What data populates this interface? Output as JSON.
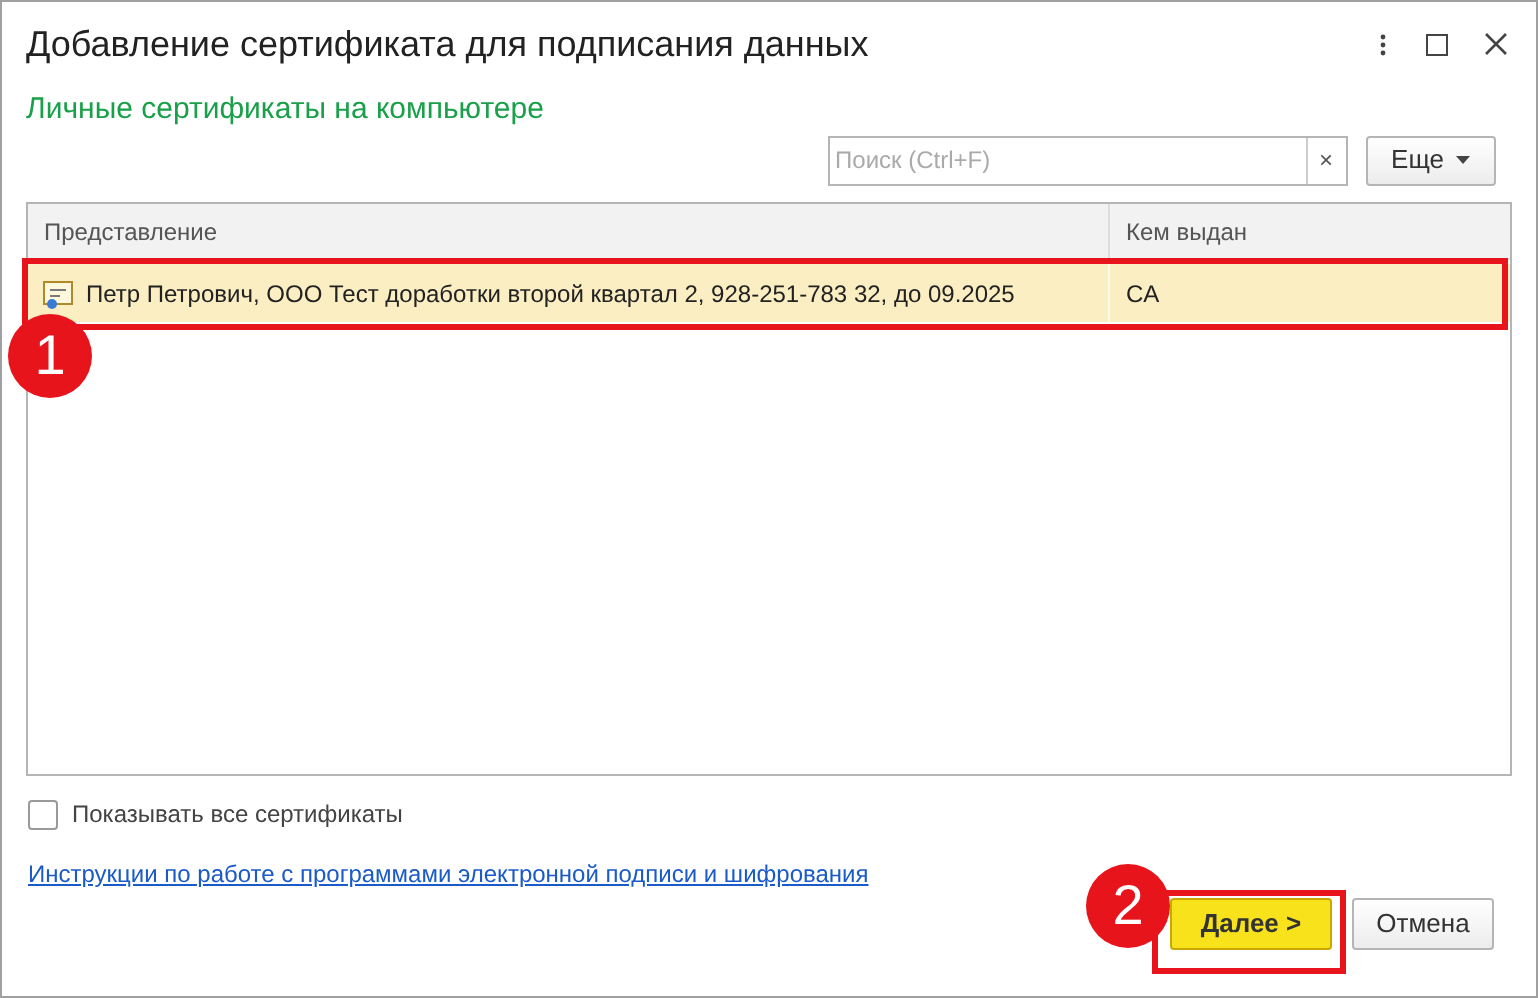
{
  "window": {
    "title": "Добавление сертификата для подписания данных"
  },
  "subtitle": "Личные сертификаты на компьютере",
  "search": {
    "placeholder": "Поиск (Ctrl+F)",
    "clear": "×"
  },
  "more_button": "Еще",
  "table": {
    "columns": [
      "Представление",
      "Кем выдан"
    ],
    "rows": [
      {
        "cells": [
          "Петр Петрович, ООО Тест доработки второй квартал 2, 928-251-783 32, до 09.2025",
          "CA"
        ],
        "selected": true
      }
    ]
  },
  "show_all": {
    "label": "Показывать все сертификаты",
    "checked": false
  },
  "link": "Инструкции по работе с программами электронной подписи и шифрования",
  "buttons": [
    {
      "label": "Далее >",
      "kind": "primary"
    },
    {
      "label": "Отмена",
      "kind": "default"
    }
  ],
  "annotations": [
    {
      "number": "1"
    },
    {
      "number": "2"
    }
  ]
}
